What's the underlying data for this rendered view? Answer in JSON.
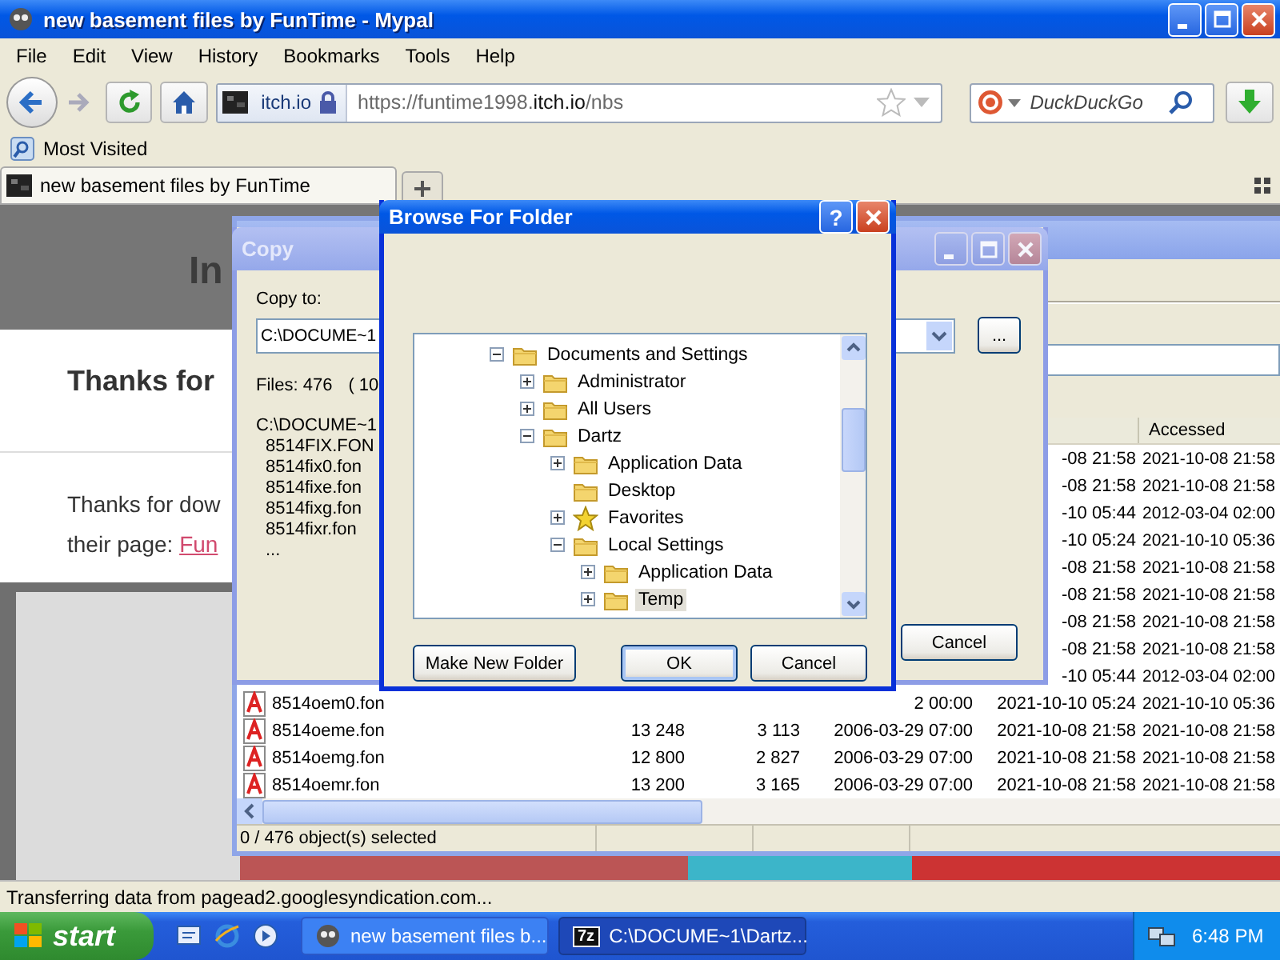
{
  "browser": {
    "title": "new basement files by FunTime - Mypal",
    "menu": [
      "File",
      "Edit",
      "View",
      "History",
      "Bookmarks",
      "Tools",
      "Help"
    ],
    "site_identity": "itch.io",
    "url": {
      "scheme": "https://funtime1998.",
      "domain": "itch.io",
      "path": "/nbs"
    },
    "search": {
      "placeholder": "DuckDuckGo"
    },
    "bookmarks": [
      "Most Visited"
    ],
    "tabs": [
      {
        "label": "new basement files by FunTime",
        "selected": true
      }
    ],
    "page": {
      "heading": "In",
      "card_title": "Thanks for",
      "paragraph": [
        "Thanks for dow",
        "their page: "
      ],
      "link": "Fun"
    },
    "status_bar": "Transferring data from pagead2.googlesyndication.com..."
  },
  "file_manager": {
    "columns": [
      {
        "label": "Accessed"
      }
    ],
    "rows": [
      {
        "created": "-08 21:58",
        "accessed": "2021-10-08 21:58"
      },
      {
        "created": "-08 21:58",
        "accessed": "2021-10-08 21:58"
      },
      {
        "created": "-10 05:44",
        "accessed": "2012-03-04 02:00"
      },
      {
        "created": "-10 05:24",
        "accessed": "2021-10-10 05:36"
      },
      {
        "created": "-08 21:58",
        "accessed": "2021-10-08 21:58"
      },
      {
        "created": "-08 21:58",
        "accessed": "2021-10-08 21:58"
      },
      {
        "created": "-08 21:58",
        "accessed": "2021-10-08 21:58"
      },
      {
        "created": "-08 21:58",
        "accessed": "2021-10-08 21:58"
      },
      {
        "created": "-10 05:44",
        "accessed": "2012-03-04 02:00"
      },
      {
        "name": "8514oem0.fon",
        "modified": "2 00:00",
        "created": "2021-10-10 05:24",
        "accessed": "2021-10-10 05:36"
      },
      {
        "name": "8514oeme.fon",
        "size": "13 248",
        "packed": "3 113",
        "modified": "2006-03-29 07:00",
        "created": "2021-10-08 21:58",
        "accessed": "2021-10-08 21:58"
      },
      {
        "name": "8514oemg.fon",
        "size": "12 800",
        "packed": "2 827",
        "modified": "2006-03-29 07:00",
        "created": "2021-10-08 21:58",
        "accessed": "2021-10-08 21:58"
      },
      {
        "name": "8514oemr.fon",
        "size": "13 200",
        "packed": "3 165",
        "modified": "2006-03-29 07:00",
        "created": "2021-10-08 21:58",
        "accessed": "2021-10-08 21:58"
      }
    ],
    "status_bar": "0 / 476 object(s) selected"
  },
  "copy_dialog": {
    "title": "Copy",
    "label": "Copy to:",
    "path": "C:\\DOCUME~1",
    "browse_button": "...",
    "files_info": "Files: 476",
    "size_info": "( 10",
    "list": [
      "C:\\DOCUME~1",
      "8514FIX.FON",
      "8514fix0.fon",
      "8514fixe.fon",
      "8514fixg.fon",
      "8514fixr.fon",
      "..."
    ],
    "buttons": [
      "Cancel"
    ]
  },
  "browse_dialog": {
    "title": "Browse For Folder",
    "help_button": "?",
    "tree": [
      {
        "label": "Documents and Settings",
        "kind": "folder",
        "expandable": true,
        "expanded": true,
        "selected": false,
        "children": [
          {
            "label": "Administrator",
            "kind": "folder",
            "expandable": true,
            "expanded": false,
            "selected": false
          },
          {
            "label": "All Users",
            "kind": "folder",
            "expandable": true,
            "expanded": false,
            "selected": false
          },
          {
            "label": "Dartz",
            "kind": "folder",
            "expandable": true,
            "expanded": true,
            "selected": false,
            "children": [
              {
                "label": "Application Data",
                "kind": "folder",
                "expandable": true,
                "expanded": false,
                "selected": false
              },
              {
                "label": "Desktop",
                "kind": "folder",
                "expandable": false,
                "expanded": false,
                "selected": false
              },
              {
                "label": "Favorites",
                "kind": "favorites",
                "expandable": true,
                "expanded": false,
                "selected": false
              },
              {
                "label": "Local Settings",
                "kind": "folder",
                "expandable": true,
                "expanded": true,
                "selected": false,
                "children": [
                  {
                    "label": "Application Data",
                    "kind": "folder",
                    "expandable": true,
                    "expanded": false,
                    "selected": false
                  },
                  {
                    "label": "Temp",
                    "kind": "folder",
                    "expandable": true,
                    "expanded": false,
                    "selected": true
                  }
                ]
              }
            ]
          }
        ]
      }
    ],
    "buttons": [
      {
        "label": "Make New Folder",
        "default": false
      },
      {
        "label": "OK",
        "default": true
      },
      {
        "label": "Cancel",
        "default": false
      }
    ]
  },
  "taskbar": {
    "start": "start",
    "tasks": [
      {
        "label": "new basement files b...",
        "selected": false
      },
      {
        "label": "C:\\DOCUME~1\\Dartz...",
        "badge": "7z",
        "selected": true
      }
    ],
    "clock": "6:48 PM"
  }
}
